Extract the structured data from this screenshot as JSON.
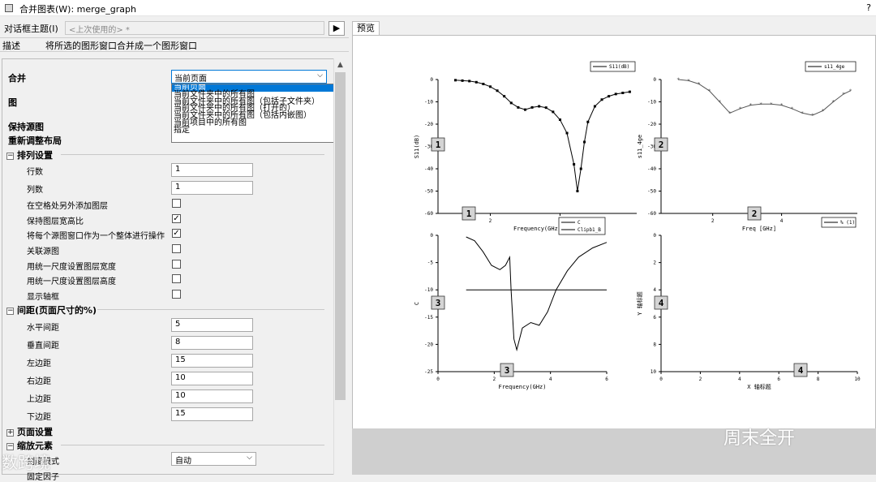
{
  "window": {
    "title": "合并图表(W): merge_graph",
    "help": "?"
  },
  "theme": {
    "label": "对话框主题(I)",
    "value": "<上次使用的> *",
    "arrow": "▶"
  },
  "description": {
    "label": "描述",
    "text": "将所选的图形窗口合并成一个图形窗口"
  },
  "merge": {
    "label": "合并",
    "selected": "当前页面",
    "options": [
      "当前页面",
      "当前文件夹中的所有图",
      "当前文件夹中的所有图（包括子文件夹）",
      "当前文件夹中的所有图（打开的）",
      "当前文件夹中的所有图（包括内嵌图）",
      "当前项目中的所有图",
      "指定"
    ]
  },
  "labels": {
    "graph": "图",
    "keep_source": "保持源图",
    "relayout": "重新调整布局"
  },
  "arrange": {
    "title": "排列设置",
    "toggle": "⊟",
    "rows_label": "行数",
    "rows": "1",
    "cols_label": "列数",
    "cols": "1",
    "add_layer_label": "在空格处另外添加图层",
    "keep_ratio_label": "保持图层宽高比",
    "whole_label": "将每个源图窗口作为一个整体进行操作",
    "link_label": "关联源图",
    "uniform_width_label": "用统一尺度设置图层宽度",
    "uniform_height_label": "用统一尺度设置图层高度",
    "show_frame_label": "显示轴框",
    "checks": [
      "",
      "✓",
      "✓",
      "",
      "",
      "",
      ""
    ]
  },
  "spacing": {
    "title": "间距(页面尺寸的%)",
    "toggle": "⊟",
    "fields": [
      {
        "label": "水平间距",
        "value": "5"
      },
      {
        "label": "垂直间距",
        "value": "8"
      },
      {
        "label": "左边距",
        "value": "15"
      },
      {
        "label": "右边距",
        "value": "10"
      },
      {
        "label": "上边距",
        "value": "10"
      },
      {
        "label": "下边距",
        "value": "15"
      }
    ]
  },
  "page_settings": {
    "title": "页面设置",
    "toggle": "⊞"
  },
  "scale": {
    "title": "缩放元素",
    "toggle": "⊟",
    "mode_label": "刻度模式",
    "mode_value": "自动",
    "font_label": "固定因子"
  },
  "preview": {
    "tab": "预览"
  },
  "watermarks": {
    "right": "周末全开",
    "left": "数跨境"
  },
  "colors": {
    "selection": "#0078d7",
    "preview_bg": "#ffffff",
    "preview_bottom": "#cfcfcf"
  },
  "chart_data": [
    {
      "type": "line",
      "panel": "1",
      "xlabel": "Frequency(GHz)",
      "ylabel": "S11(dB)",
      "legend": [
        "S11(dB)"
      ],
      "legend_position": "top-right",
      "ylim": [
        -60,
        0
      ],
      "yticks": [
        "0",
        "-10",
        "-20",
        "-30",
        "-40",
        "-50",
        "-60"
      ],
      "xticks": [
        "2",
        "4"
      ],
      "x": [
        1.0,
        1.2,
        1.4,
        1.6,
        1.8,
        2.0,
        2.2,
        2.4,
        2.6,
        2.8,
        3.0,
        3.2,
        3.4,
        3.6,
        3.8,
        4.0,
        4.2,
        4.4,
        4.5,
        4.6,
        4.7,
        4.8,
        5.0,
        5.2,
        5.4,
        5.6,
        5.8,
        6.0
      ],
      "y": [
        -0.3,
        -0.5,
        -0.7,
        -1.2,
        -2.0,
        -3.2,
        -5,
        -7.5,
        -10.5,
        -12.5,
        -13.5,
        -12.5,
        -12,
        -12.6,
        -14.5,
        -18,
        -24,
        -38,
        -50,
        -40,
        -28,
        -19,
        -12,
        -9,
        -7.5,
        -6.5,
        -6,
        -5.5
      ]
    },
    {
      "type": "line",
      "panel": "2",
      "xlabel": "Freq [GHz]",
      "ylabel": "s11_4ge",
      "legend": [
        "s11_4ge"
      ],
      "legend_position": "top-right",
      "ylim": [
        -60,
        0
      ],
      "yticks": [
        "0",
        "-10",
        "-20",
        "-30",
        "-40",
        "-50",
        "-60"
      ],
      "xticks": [
        "2",
        "4"
      ],
      "x": [
        1.0,
        1.3,
        1.6,
        1.9,
        2.2,
        2.5,
        2.8,
        3.1,
        3.4,
        3.7,
        4.0,
        4.3,
        4.6,
        4.9,
        5.2,
        5.5,
        5.8,
        6.0
      ],
      "y": [
        0,
        -0.5,
        -2,
        -5,
        -10,
        -15,
        -13,
        -11.5,
        -11,
        -11,
        -11.5,
        -13,
        -15,
        -16,
        -14,
        -10,
        -6.5,
        -5
      ]
    },
    {
      "type": "line",
      "panel": "3",
      "xlabel": "Frequency(GHz)",
      "ylabel": "C",
      "legend": [
        "C",
        "Clipb1_B"
      ],
      "legend_position": "top-right",
      "ylim": [
        -25,
        0
      ],
      "xlim": [
        0,
        6
      ],
      "yticks": [
        "0",
        "-5",
        "-10",
        "-15",
        "-20",
        "-25"
      ],
      "xticks": [
        "0",
        "2",
        "4",
        "6"
      ],
      "series": [
        {
          "name": "C",
          "x": [
            1.0,
            1.3,
            1.6,
            1.9,
            2.2,
            2.4,
            2.55,
            2.6,
            2.7,
            2.8,
            3.0,
            3.3,
            3.6,
            3.9,
            4.2,
            4.6,
            5.0,
            5.5,
            6.0
          ],
          "y": [
            -0.3,
            -1,
            -3,
            -5.5,
            -6.3,
            -5.5,
            -4,
            -10,
            -19,
            -21,
            -17,
            -16,
            -16.5,
            -14,
            -10,
            -6.5,
            -4,
            -2.3,
            -1.3
          ]
        },
        {
          "name": "Clipb1_B",
          "x": [
            1.0,
            6.0
          ],
          "y": [
            -10,
            -10
          ]
        }
      ]
    },
    {
      "type": "line",
      "panel": "4",
      "xlabel": "X 轴标题",
      "ylabel": "Y 轴标题",
      "legend": [
        "% (1)"
      ],
      "legend_position": "top-right",
      "ylim": [
        0,
        10
      ],
      "xlim": [
        0,
        10
      ],
      "yticks": [
        "0",
        "2",
        "4",
        "6",
        "8",
        "10"
      ],
      "xticks": [
        "0",
        "2",
        "4",
        "6",
        "8",
        "10"
      ],
      "series": []
    }
  ]
}
